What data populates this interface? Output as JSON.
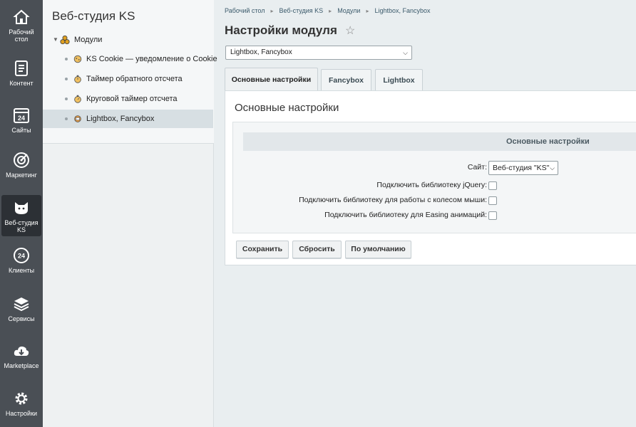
{
  "rail": [
    {
      "icon": "home-icon",
      "label": "Рабочий стол"
    },
    {
      "icon": "content-icon",
      "label": "Контент"
    },
    {
      "icon": "calendar-24-icon",
      "label": "Сайты"
    },
    {
      "icon": "target-icon",
      "label": "Маркетинг"
    },
    {
      "icon": "cat-icon",
      "label": "Веб-студия KS"
    },
    {
      "icon": "clients-24-icon",
      "label": "Клиенты"
    },
    {
      "icon": "layers-icon",
      "label": "Сервисы"
    },
    {
      "icon": "cloud-download-icon",
      "label": "Marketplace"
    },
    {
      "icon": "gear-icon",
      "label": "Настройки"
    }
  ],
  "tree": {
    "title": "Веб-студия KS",
    "root": "Модули",
    "items": [
      {
        "label": "KS Cookie — уведомление о Cookie"
      },
      {
        "label": "Таймер обратного отсчета"
      },
      {
        "label": "Круговой таймер отсчета"
      },
      {
        "label": "Lightbox, Fancybox"
      }
    ]
  },
  "breadcrumb": [
    "Рабочий стол",
    "Веб-студия KS",
    "Модули",
    "Lightbox, Fancybox"
  ],
  "page_title": "Настройки модуля",
  "module_select": {
    "value": "Lightbox, Fancybox"
  },
  "tabs": [
    "Основные настройки",
    "Fancybox",
    "Lightbox"
  ],
  "panel": {
    "title": "Основные настройки",
    "section_header": "Основные настройки",
    "site_label": "Сайт:",
    "site_value": "Веб-студия \"KS\"",
    "fields": [
      {
        "label": "Подключить библиотеку jQuery:",
        "checked": false
      },
      {
        "label": "Подключить библиотеку для работы с колесом мыши:",
        "checked": false
      },
      {
        "label": "Подключить библиотеку для Easing анимаций:",
        "checked": false
      }
    ]
  },
  "buttons": {
    "save": "Сохранить",
    "reset": "Сбросить",
    "default": "По умолчанию"
  }
}
